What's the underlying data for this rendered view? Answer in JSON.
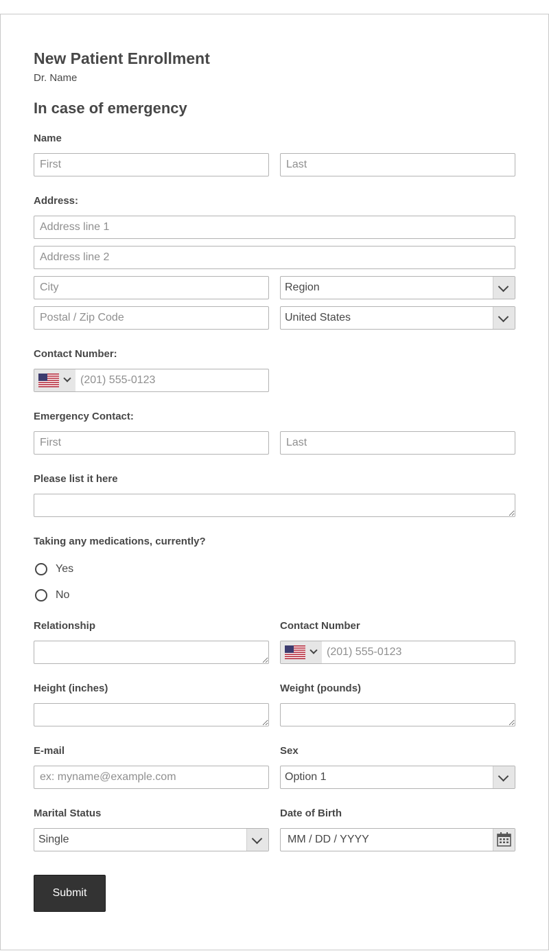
{
  "form": {
    "title": "New Patient Enrollment",
    "subtitle": "Dr. Name",
    "section": "In case of emergency",
    "name": {
      "label": "Name",
      "first_placeholder": "First",
      "last_placeholder": "Last"
    },
    "address": {
      "label": "Address:",
      "line1_placeholder": "Address line 1",
      "line2_placeholder": "Address line 2",
      "city_placeholder": "City",
      "region_value": "Region",
      "postal_placeholder": "Postal / Zip Code",
      "country_value": "United States"
    },
    "contact_number": {
      "label": "Contact Number:",
      "placeholder": "(201) 555-0123",
      "flag_icon": "us-flag-icon"
    },
    "emergency_contact": {
      "label": "Emergency Contact:",
      "first_placeholder": "First",
      "last_placeholder": "Last"
    },
    "list_here": {
      "label": "Please list it here"
    },
    "medications": {
      "label": "Taking any medications, currently?",
      "options": [
        "Yes",
        "No"
      ]
    },
    "relationship": {
      "label": "Relationship"
    },
    "contact_number_2": {
      "label": "Contact Number",
      "placeholder": "(201) 555-0123"
    },
    "height": {
      "label": "Height (inches)"
    },
    "weight": {
      "label": "Weight (pounds)"
    },
    "email": {
      "label": "E-mail",
      "placeholder": "ex: myname@example.com"
    },
    "sex": {
      "label": "Sex",
      "value": "Option 1"
    },
    "marital": {
      "label": "Marital Status",
      "value": "Single"
    },
    "dob": {
      "label": "Date of Birth",
      "placeholder": "MM / DD / YYYY"
    },
    "submit_label": "Submit"
  },
  "colors": {
    "text": "#474747",
    "border": "#b3b3b3",
    "button": "#333333",
    "arrow_bg": "#e6e6e6"
  }
}
